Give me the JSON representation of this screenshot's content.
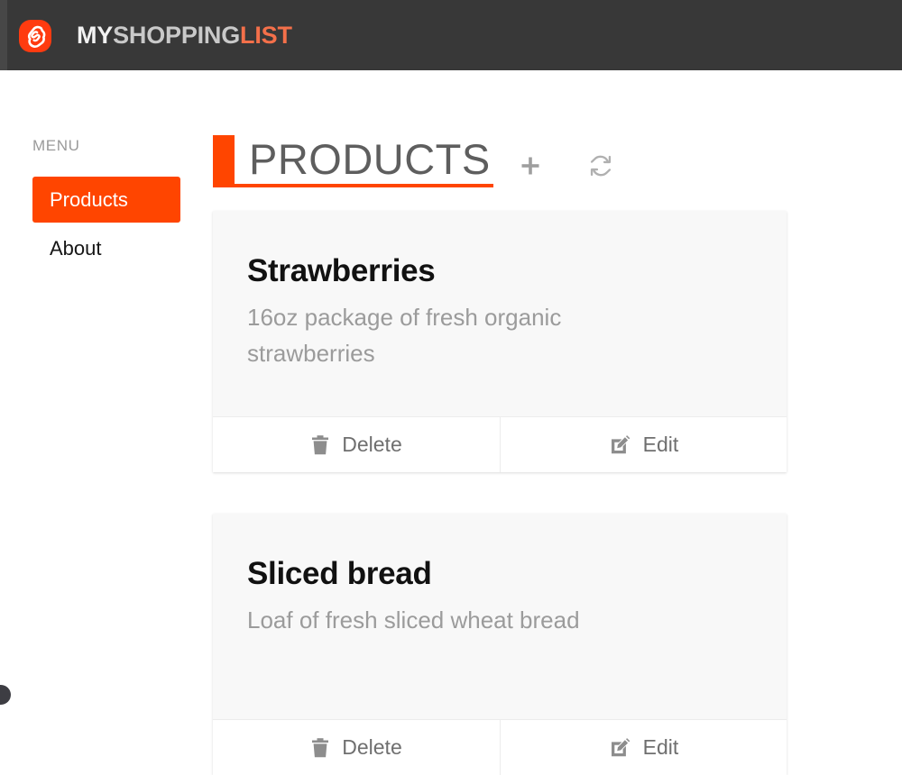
{
  "brand": {
    "logo_icon": "svelte-s-logo",
    "title_part1": "MY",
    "title_part2": "SHOPPING",
    "title_part3": "LIST",
    "accent_color": "#ff4500",
    "bar_color": "#383838"
  },
  "sidebar": {
    "label": "MENU",
    "items": [
      {
        "label": "Products",
        "active": true
      },
      {
        "label": "About",
        "active": false
      }
    ]
  },
  "main": {
    "page_title": "PRODUCTS",
    "actions": [
      {
        "name": "add",
        "icon": "plus-icon",
        "label": "+"
      },
      {
        "name": "refresh",
        "icon": "sync-refresh-icon",
        "label": ""
      }
    ],
    "cards": [
      {
        "title": "Strawberries",
        "description": "16oz package of fresh organic strawberries",
        "delete_label": "Delete",
        "edit_label": "Edit",
        "delete_icon": "trash-icon",
        "edit_icon": "edit-pencil-icon"
      },
      {
        "title": "Sliced bread",
        "description": "Loaf of fresh sliced wheat bread",
        "delete_label": "Delete",
        "edit_label": "Edit",
        "delete_icon": "trash-icon",
        "edit_icon": "edit-pencil-icon"
      }
    ]
  }
}
